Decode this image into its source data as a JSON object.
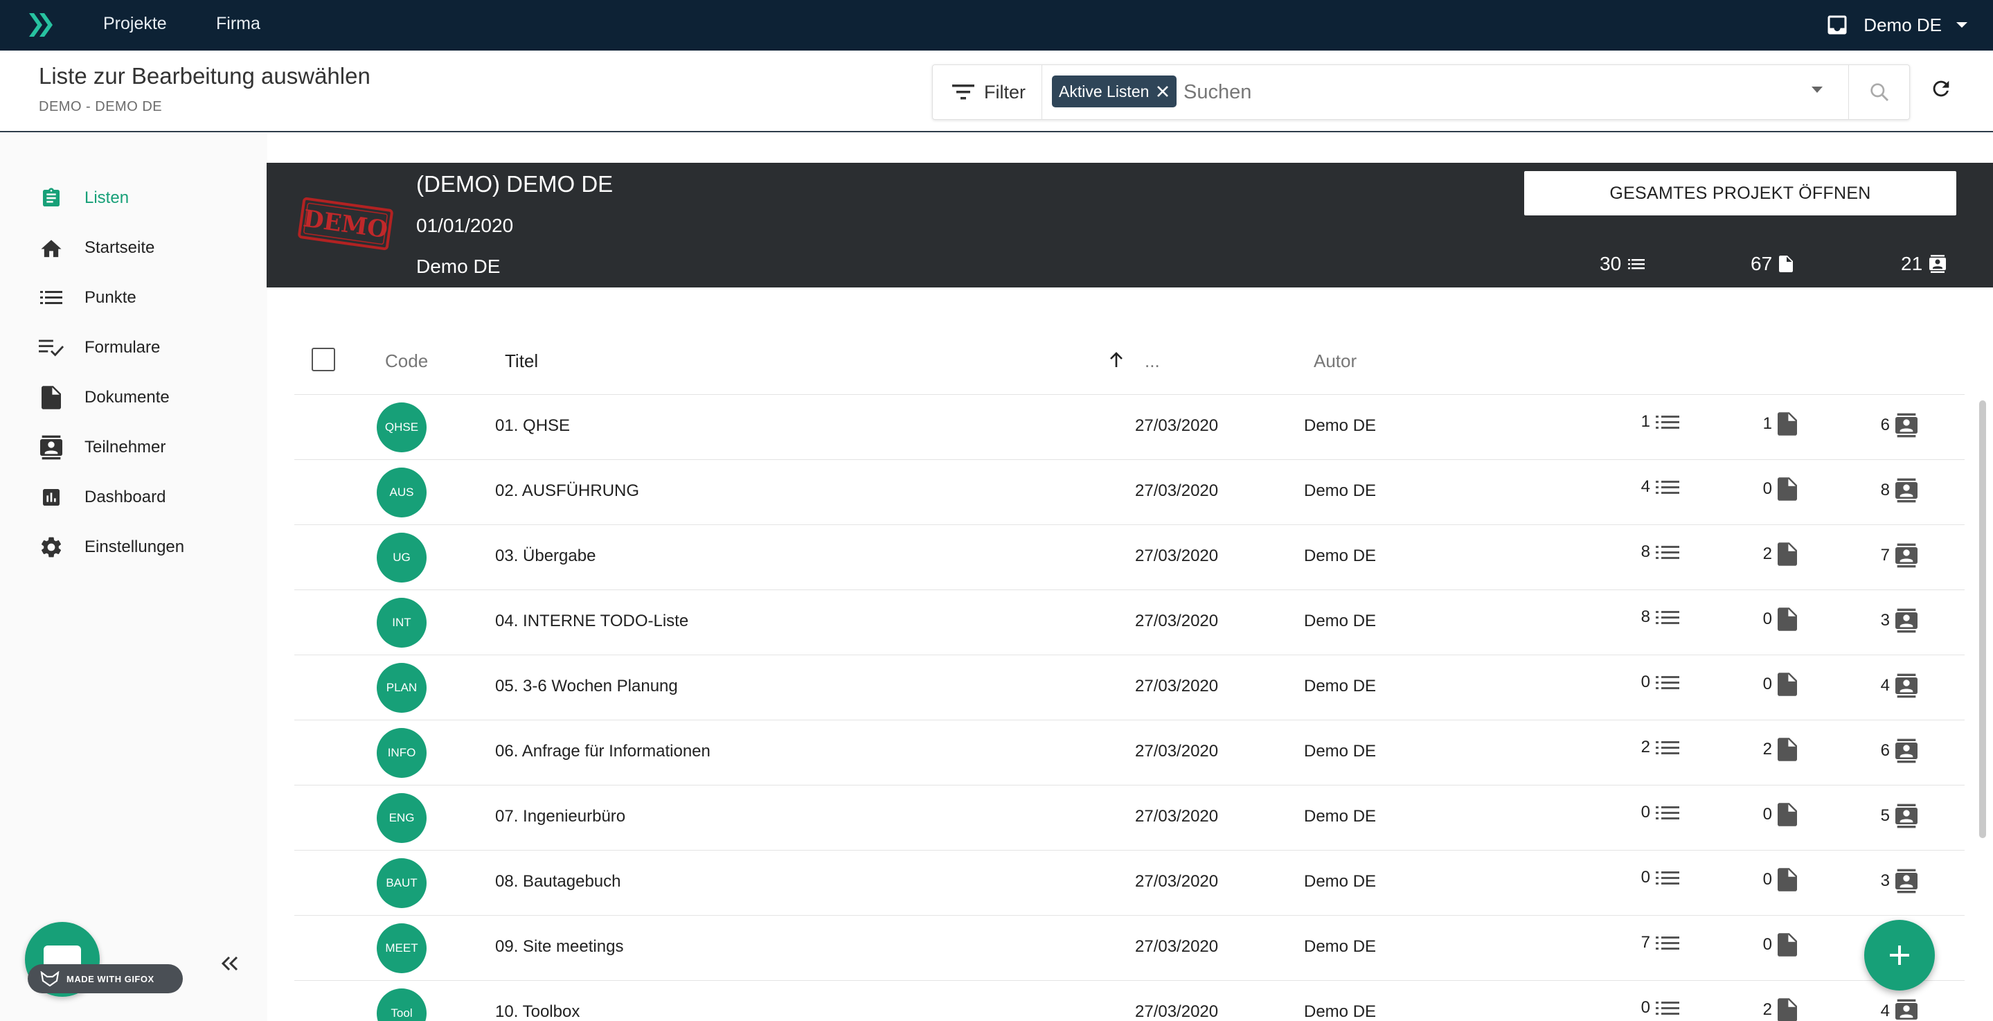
{
  "topbar": {
    "nav": [
      "Projekte",
      "Firma"
    ],
    "user_label": "Demo DE",
    "icons": [
      "app-logo-icon",
      "inbox-icon",
      "caret-down-icon"
    ]
  },
  "header": {
    "title": "Liste zur Bearbeitung auswählen",
    "subtitle": "DEMO - DEMO DE",
    "filter_label": "Filter",
    "chip_label": "Aktive Listen",
    "search_placeholder": "Suchen"
  },
  "sidebar": {
    "items": [
      {
        "label": "Listen",
        "icon": "clipboard-list-icon",
        "active": true
      },
      {
        "label": "Startseite",
        "icon": "home-icon",
        "active": false
      },
      {
        "label": "Punkte",
        "icon": "list-icon",
        "active": false
      },
      {
        "label": "Formulare",
        "icon": "checklist-icon",
        "active": false
      },
      {
        "label": "Dokumente",
        "icon": "document-icon",
        "active": false
      },
      {
        "label": "Teilnehmer",
        "icon": "contacts-icon",
        "active": false
      },
      {
        "label": "Dashboard",
        "icon": "bar-chart-icon",
        "active": false
      },
      {
        "label": "Einstellungen",
        "icon": "gear-icon",
        "active": false
      }
    ],
    "badge_text": "MADE WITH GIFOX"
  },
  "project": {
    "stamp_text": "DEMO",
    "name": "(DEMO) DEMO DE",
    "date": "01/01/2020",
    "owner": "Demo DE",
    "open_button": "GESAMTES PROJEKT ÖFFNEN",
    "stats": {
      "lists": "30",
      "documents": "67",
      "participants": "21"
    }
  },
  "table": {
    "headers": {
      "code": "Code",
      "title": "Titel",
      "dots": "...",
      "author": "Autor"
    },
    "rows": [
      {
        "code": "QHSE",
        "title": "01. QHSE",
        "date": "27/03/2020",
        "author": "Demo DE",
        "points": "1",
        "docs": "1",
        "members": "6"
      },
      {
        "code": "AUS",
        "title": "02. AUSFÜHRUNG",
        "date": "27/03/2020",
        "author": "Demo DE",
        "points": "4",
        "docs": "0",
        "members": "8"
      },
      {
        "code": "UG",
        "title": "03. Übergabe",
        "date": "27/03/2020",
        "author": "Demo DE",
        "points": "8",
        "docs": "2",
        "members": "7"
      },
      {
        "code": "INT",
        "title": "04. INTERNE TODO-Liste",
        "date": "27/03/2020",
        "author": "Demo DE",
        "points": "8",
        "docs": "0",
        "members": "3"
      },
      {
        "code": "PLAN",
        "title": "05. 3-6 Wochen Planung",
        "date": "27/03/2020",
        "author": "Demo DE",
        "points": "0",
        "docs": "0",
        "members": "4"
      },
      {
        "code": "INFO",
        "title": "06. Anfrage für Informationen",
        "date": "27/03/2020",
        "author": "Demo DE",
        "points": "2",
        "docs": "2",
        "members": "6"
      },
      {
        "code": "ENG",
        "title": "07. Ingenieurbüro",
        "date": "27/03/2020",
        "author": "Demo DE",
        "points": "0",
        "docs": "0",
        "members": "5"
      },
      {
        "code": "BAUT",
        "title": "08. Bautagebuch",
        "date": "27/03/2020",
        "author": "Demo DE",
        "points": "0",
        "docs": "0",
        "members": "3"
      },
      {
        "code": "MEET",
        "title": "09. Site meetings",
        "date": "27/03/2020",
        "author": "Demo DE",
        "points": "7",
        "docs": "0",
        "members": ""
      },
      {
        "code": "Tool",
        "title": "10. Toolbox",
        "date": "27/03/2020",
        "author": "Demo DE",
        "points": "0",
        "docs": "2",
        "members": "4"
      }
    ]
  },
  "colors": {
    "accent": "#17a078",
    "topbar": "#0d2235",
    "banner": "#2b2e31",
    "chip": "#2f4558"
  }
}
